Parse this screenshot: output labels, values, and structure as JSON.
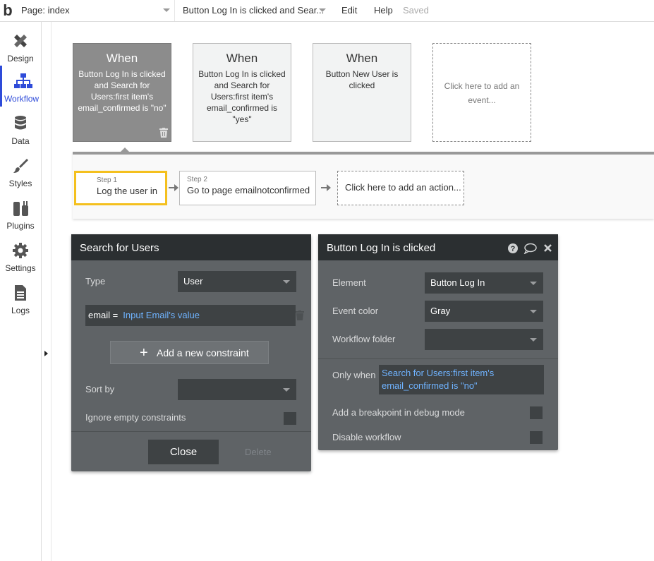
{
  "topbar": {
    "logo": "b",
    "page_select": "Page: index",
    "workflow_select": "Button Log In is clicked and Sear...",
    "menu_edit": "Edit",
    "menu_help": "Help",
    "status_saved": "Saved"
  },
  "sidebar": {
    "items": [
      {
        "label": "Design",
        "icon": "design-icon"
      },
      {
        "label": "Workflow",
        "icon": "workflow-icon",
        "active": true
      },
      {
        "label": "Data",
        "icon": "database-icon"
      },
      {
        "label": "Styles",
        "icon": "brush-icon"
      },
      {
        "label": "Plugins",
        "icon": "plug-icon"
      },
      {
        "label": "Settings",
        "icon": "gear-icon"
      },
      {
        "label": "Logs",
        "icon": "document-icon"
      }
    ]
  },
  "events": [
    {
      "when": "When",
      "description": "Button Log In is clicked and Search for Users:first item's email_confirmed is \"no\""
    },
    {
      "when": "When",
      "description": "Button Log In is clicked and Search for Users:first item's email_confirmed is \"yes\""
    },
    {
      "when": "When",
      "description": "Button New User is clicked"
    }
  ],
  "add_event": "Click here to add an event...",
  "steps": [
    {
      "number": "Step 1",
      "action": "Log the user in"
    },
    {
      "number": "Step 2",
      "action": "Go to page emailnotconfirmed"
    }
  ],
  "add_action": "Click here to add an action...",
  "search_panel": {
    "title": "Search for Users",
    "type_label": "Type",
    "type_value": "User",
    "constraint_key": "email =",
    "constraint_value": "Input Email's value",
    "add_constraint": "Add a new constraint",
    "sortby_label": "Sort by",
    "sortby_value": "",
    "ignore_label": "Ignore empty constraints",
    "close": "Close",
    "delete": "Delete"
  },
  "workflow_panel": {
    "title": "Button Log In is clicked",
    "element_label": "Element",
    "element_value": "Button Log In",
    "color_label": "Event color",
    "color_value": "Gray",
    "folder_label": "Workflow folder",
    "folder_value": "",
    "onlywhen_label": "Only when",
    "onlywhen_value": "Search for Users:first item's email_confirmed is \"no\"",
    "breakpoint_label": "Add a breakpoint in debug mode",
    "disable_label": "Disable workflow"
  },
  "colors": {
    "accent": "#2e4bd9",
    "highlight": "#f4c01e",
    "link": "#6fb3ff",
    "panel_bg": "#5f6366",
    "panel_header": "#2b2f31"
  }
}
